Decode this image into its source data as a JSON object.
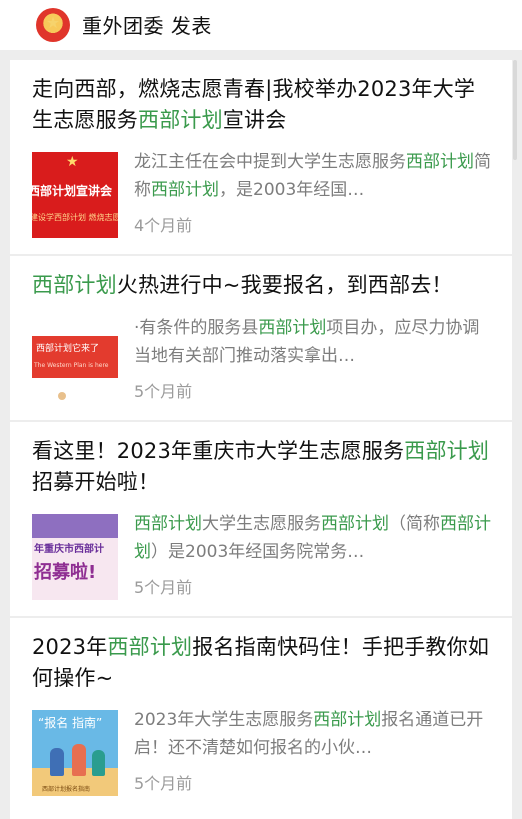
{
  "account": {
    "name": "重外团委",
    "action": "发表"
  },
  "articles": [
    {
      "title_parts": [
        "走向西部，燃烧志愿青春|我校举办2023年大学生志愿服务",
        "西部计划",
        "宣讲会"
      ],
      "snippet_parts": [
        "龙江主任在会中提到大学生志愿服务",
        "西部计划",
        "简称",
        "西部计划",
        "，是2003年经国…"
      ],
      "time": "4个月前",
      "thumb": {
        "text": "西部计划宣讲会",
        "sub": "建设学西部计划 燃烧志愿青春"
      }
    },
    {
      "title_parts": [
        "西部计划",
        "火热进行中~我要报名，到西部去！"
      ],
      "snippet_parts": [
        "·有条件的服务县",
        "西部计划",
        "项目办，应尽力协调当地有关部门推动落实拿出…"
      ],
      "time": "5个月前",
      "thumb": {
        "text": "西部计划它来了",
        "sub": "The Western Plan is here"
      }
    },
    {
      "title_parts": [
        "看这里！2023年重庆市大学生志愿服务",
        "西部计划",
        "招募开始啦！"
      ],
      "snippet_parts": [
        "西部计划",
        "大学生志愿服务",
        "西部计划",
        "（简称",
        "西部计划",
        "）是2003年经国务院常务…"
      ],
      "time": "5个月前",
      "thumb": {
        "text": "年重庆市西部计",
        "big": "招募啦!"
      }
    },
    {
      "title_parts": [
        "2023年",
        "西部计划",
        "报名指南快码住！手把手教你如何操作~"
      ],
      "snippet_parts": [
        "2023年大学生志愿服务",
        "西部计划",
        "报名通道已开启！还不清楚如何报名的小伙…"
      ],
      "time": "5个月前",
      "thumb": {
        "text": "“报名 指南”",
        "sub": "西部计划报名指南"
      }
    }
  ],
  "colors": {
    "highlight": "#3a9a4c",
    "background": "#ededed",
    "card": "#ffffff",
    "meta_text": "#9b9b9b"
  }
}
